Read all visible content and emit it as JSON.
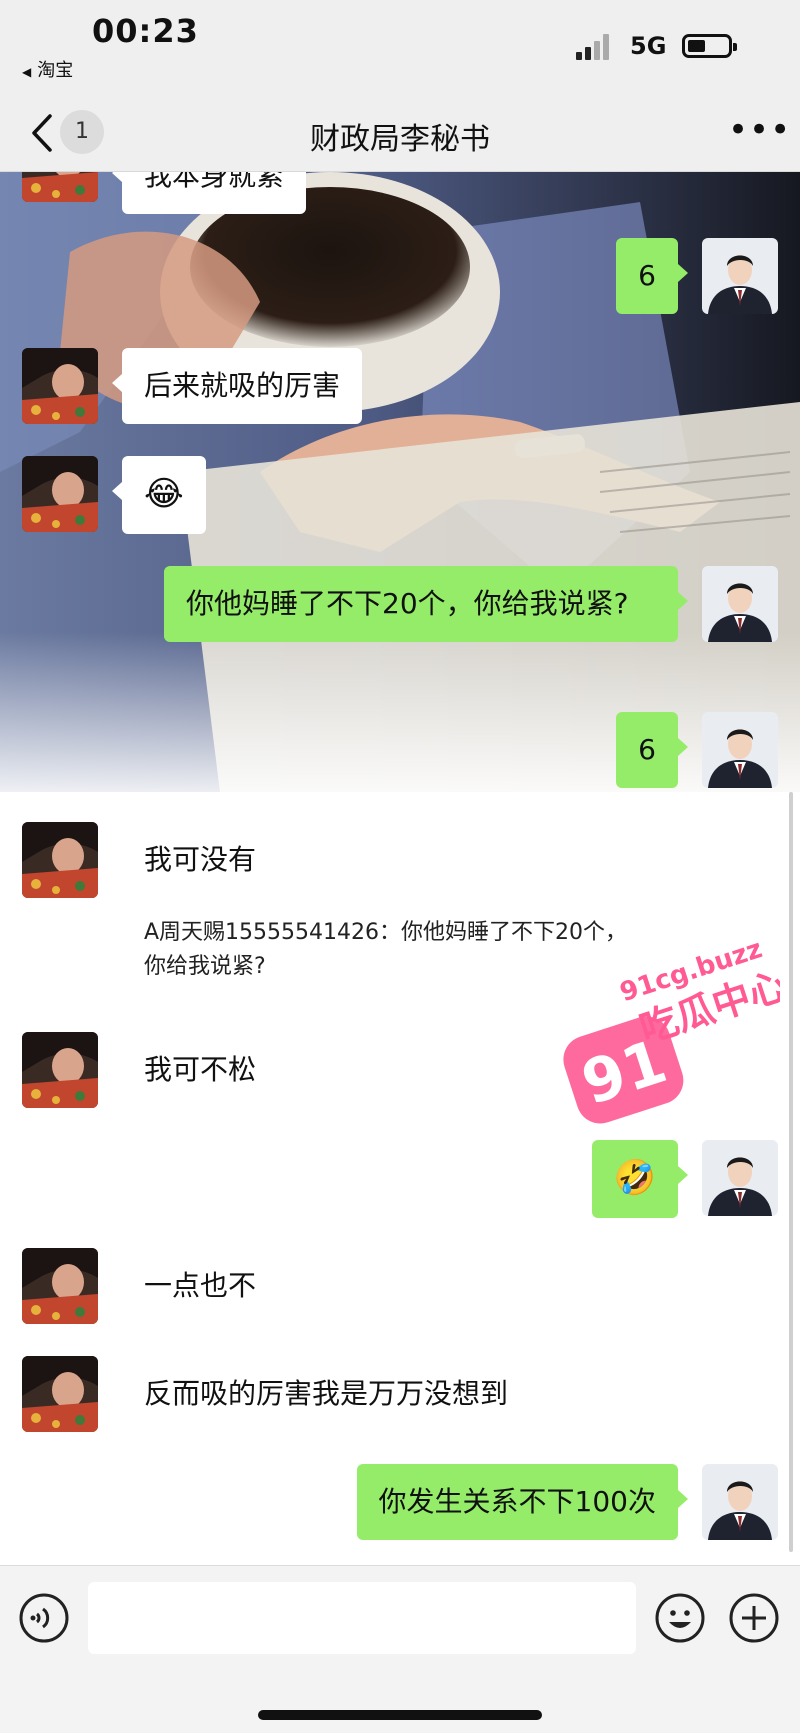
{
  "status_bar": {
    "time": "00:23",
    "back_app": "淘宝",
    "network": "5G",
    "battery_level": 0.45
  },
  "nav": {
    "unread_count": "1",
    "title": "财政局李秘书"
  },
  "colors": {
    "outgoing_bubble": "#95ec69",
    "incoming_bubble": "#ffffff",
    "chrome_bg": "#efefef"
  },
  "messages": [
    {
      "side": "left",
      "text": "我本身就紧"
    },
    {
      "side": "right",
      "text": "6"
    },
    {
      "side": "left",
      "text": "后来就吸的厉害"
    },
    {
      "side": "left",
      "icon": "laughing-emoji"
    },
    {
      "side": "right",
      "text": "你他妈睡了不下20个，你给我说紧?"
    },
    {
      "side": "right",
      "text": "6"
    },
    {
      "side": "left",
      "text": "我可没有",
      "quote": "A周天赐15555541426：你他妈睡了不下20个，你给我说紧?"
    },
    {
      "side": "left",
      "text": "我可不松"
    },
    {
      "side": "right",
      "icon": "crying-laughing-emoji"
    },
    {
      "side": "left",
      "text": "一点也不"
    },
    {
      "side": "left",
      "text": "反而吸的厉害我是万万没想到"
    },
    {
      "side": "right",
      "text": "你发生关系不下100次"
    }
  ],
  "watermark": {
    "number": "91",
    "domain": "91cg.buzz",
    "label": "吃瓜中心"
  },
  "input_bar": {
    "left_icon": "voice-icon",
    "emoji_icon": "emoji-icon",
    "plus_icon": "plus-icon"
  }
}
